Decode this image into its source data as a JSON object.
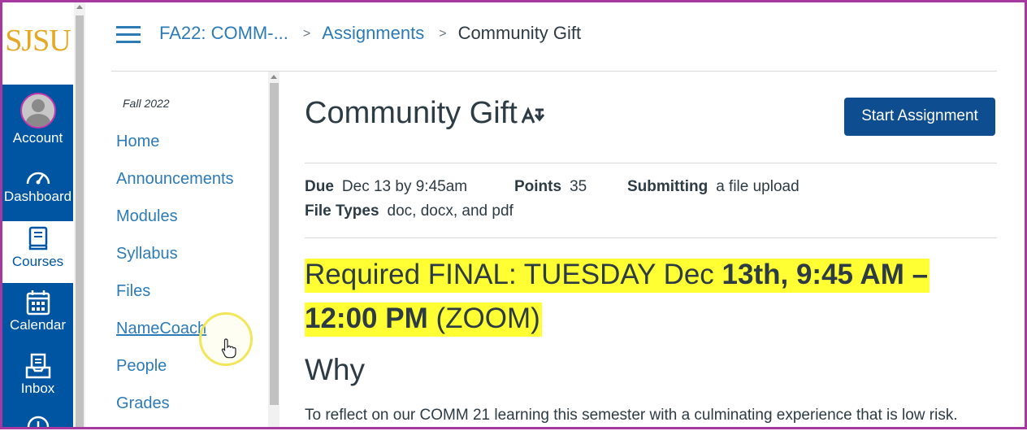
{
  "global_nav": {
    "logo": "SJSU",
    "items": [
      {
        "label": "Account",
        "icon": "avatar"
      },
      {
        "label": "Dashboard",
        "icon": "dashboard-gauge-icon"
      },
      {
        "label": "Courses",
        "icon": "courses-book-icon"
      },
      {
        "label": "Calendar",
        "icon": "calendar-icon"
      },
      {
        "label": "Inbox",
        "icon": "inbox-icon"
      }
    ]
  },
  "header": {
    "breadcrumb": {
      "course": "FA22: COMM-...",
      "section": "Assignments",
      "current": "Community Gift"
    }
  },
  "course_nav": {
    "term": "Fall 2022",
    "items": [
      "Home",
      "Announcements",
      "Modules",
      "Syllabus",
      "Files",
      "NameCoach",
      "People",
      "Grades"
    ]
  },
  "assignment": {
    "title": "Community Gift",
    "start_button": "Start Assignment",
    "due_label": "Due",
    "due_value": "Dec 13 by 9:45am",
    "points_label": "Points",
    "points_value": "35",
    "submitting_label": "Submitting",
    "submitting_value": "a file upload",
    "file_types_label": "File Types",
    "file_types_value": "doc, docx, and pdf",
    "highlight_line1_normal": "Required FINAL: TUESDAY Dec ",
    "highlight_line1_bold": "13th, 9:45 AM –",
    "highlight_line2_bold": "12:00 PM",
    "highlight_line2_normal": " (ZOOM)",
    "why_heading": "Why",
    "description": "To reflect on our COMM 21 learning this semester with a culminating experience that is low risk."
  },
  "colors": {
    "brand_blue": "#0055a2",
    "link_blue": "#2d7bb6",
    "button_blue": "#0e4d8f",
    "logo_gold": "#e5a823",
    "highlight_yellow": "#ffff33"
  }
}
